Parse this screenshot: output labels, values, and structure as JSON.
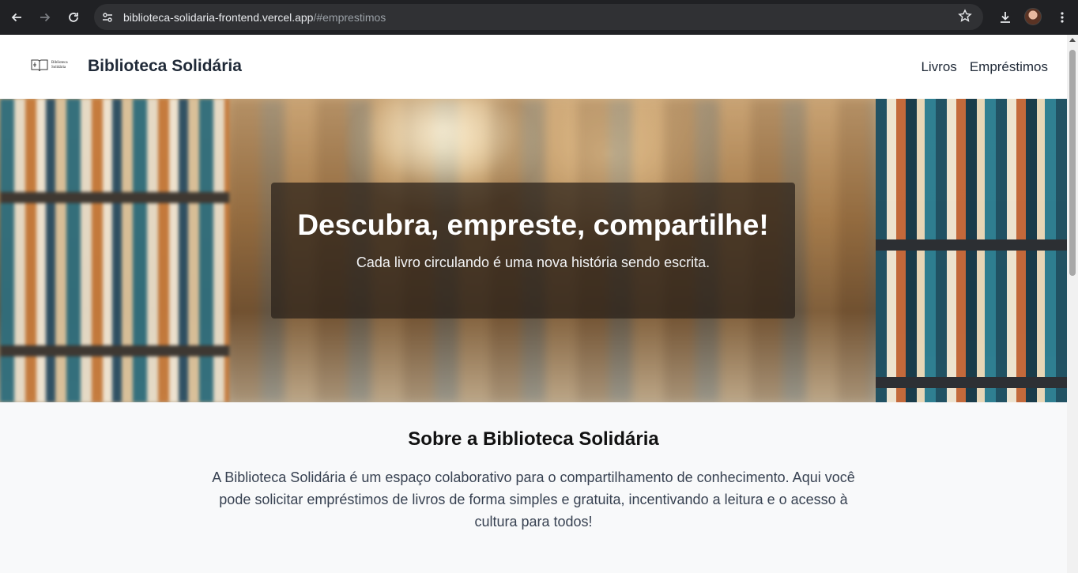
{
  "browser": {
    "url_host": "biblioteca-solidaria-frontend.vercel.app",
    "url_path": "/#emprestimos"
  },
  "site": {
    "logo_text_line1": "Biblioteca",
    "logo_text_line2": "Solidária",
    "brand": "Biblioteca Solidária",
    "nav": [
      {
        "label": "Livros"
      },
      {
        "label": "Empréstimos"
      }
    ]
  },
  "hero": {
    "title": "Descubra, empreste, compartilhe!",
    "subtitle": "Cada livro circulando é uma nova história sendo escrita."
  },
  "about": {
    "title": "Sobre a Biblioteca Solidária",
    "text": "A Biblioteca Solidária é um espaço colaborativo para o compartilhamento de conhecimento. Aqui você pode solicitar empréstimos de livros de forma simples e gratuita, incentivando a leitura e o acesso à cultura para todos!"
  },
  "icons": {
    "back": "back-arrow-icon",
    "forward": "forward-arrow-icon",
    "reload": "reload-icon",
    "site_info": "site-info-icon",
    "bookmark": "star-icon",
    "download": "download-icon",
    "menu": "kebab-menu-icon"
  },
  "colors": {
    "chrome_bg": "#202124",
    "omnibox_bg": "#303134",
    "brand_text": "#1f2937",
    "about_bg": "#f8f9fa",
    "hero_overlay": "#282019"
  }
}
